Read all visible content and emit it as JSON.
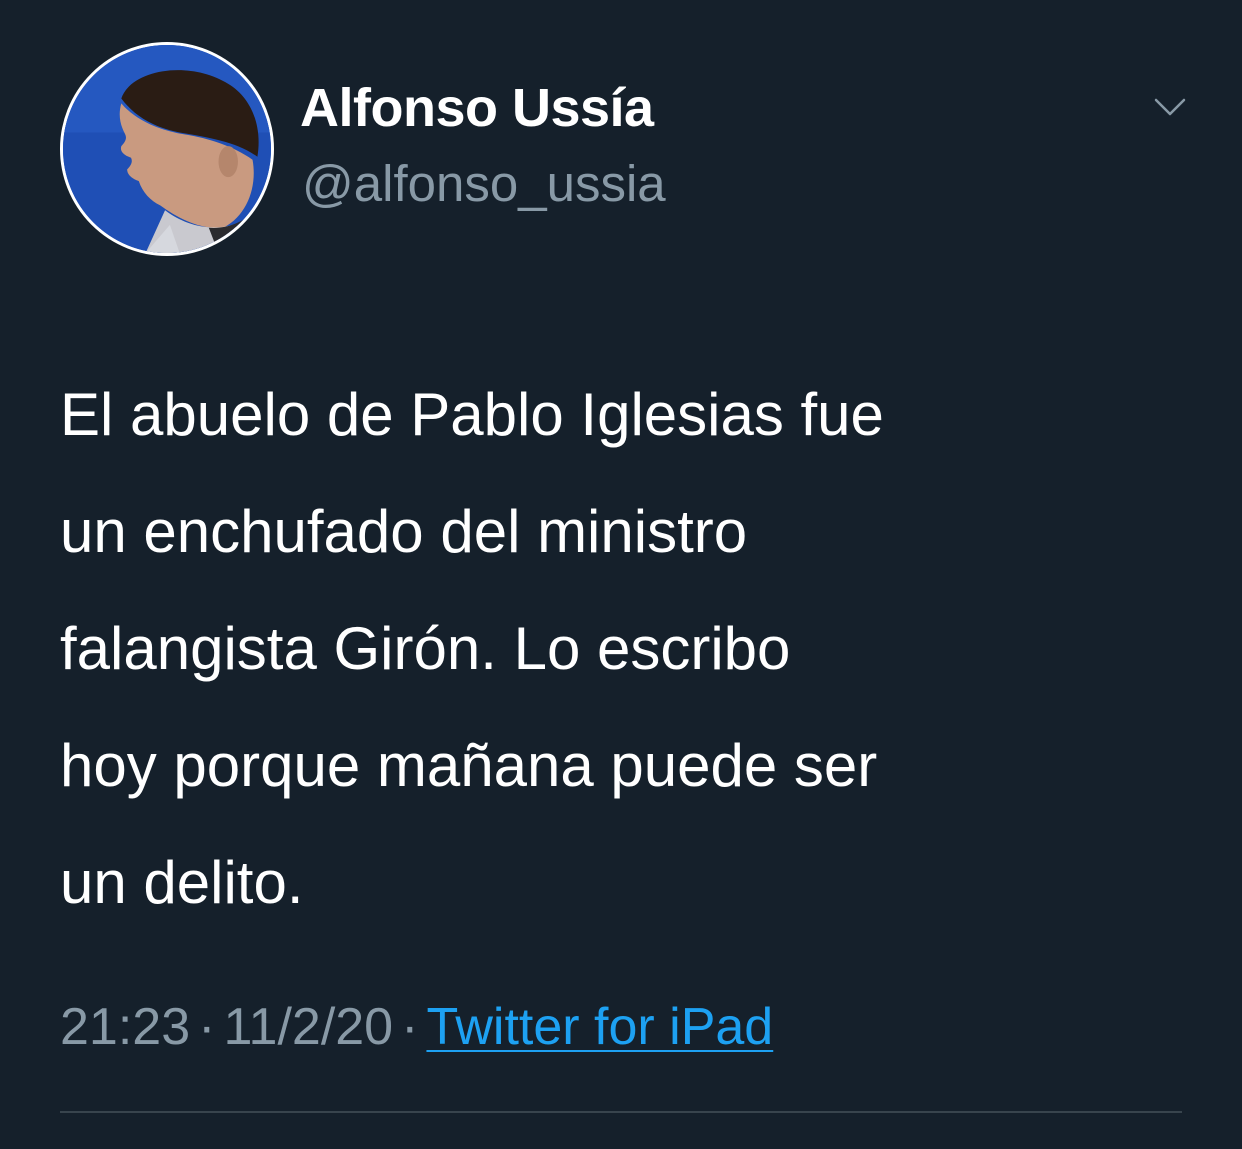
{
  "tweet": {
    "author": {
      "display_name": "Alfonso Ussía",
      "handle": "@alfonso_ussia",
      "avatar_icon": "profile-photo"
    },
    "menu_icon": "chevron-down-icon",
    "lines": [
      "El abuelo de Pablo Iglesias fue",
      "un enchufado del ministro",
      "falangista Girón. Lo escribo",
      "hoy porque mañana puede ser",
      "un delito."
    ],
    "time": "21:23",
    "date": "11/2/20",
    "separator": "·",
    "source": "Twitter for iPad"
  },
  "colors": {
    "background": "#15202b",
    "text": "#ffffff",
    "secondary": "#8899a6",
    "link": "#1da1f2",
    "divider": "#38444d"
  }
}
